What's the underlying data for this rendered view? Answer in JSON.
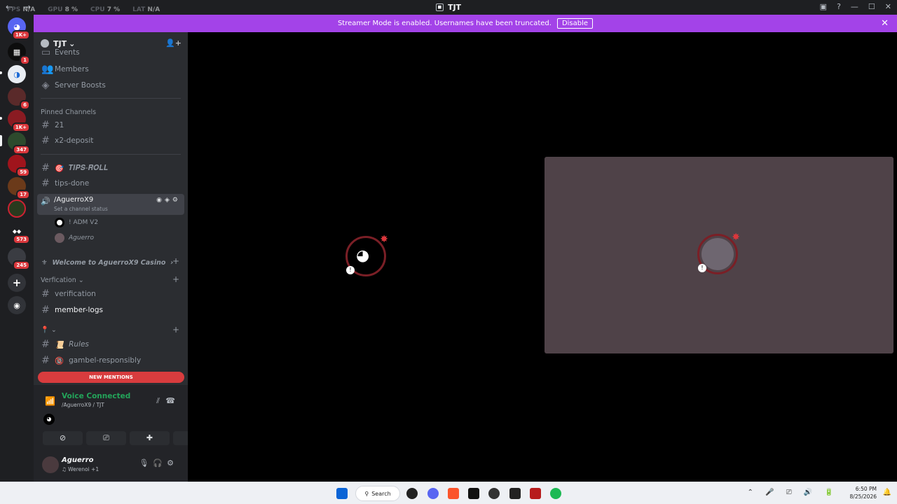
{
  "titlebar": {
    "title": "TJT",
    "stats": {
      "fps_label": "FPS",
      "fps": "N/A",
      "gpu_label": "GPU",
      "gpu": "8 %",
      "cpu_label": "CPU",
      "cpu": "7 %",
      "lat_label": "LAT",
      "lat": "N/A"
    }
  },
  "banner": {
    "text": "Streamer Mode is enabled. Usernames have been truncated.",
    "button": "Disable"
  },
  "guilds": [
    {
      "badge": "1K+"
    },
    {
      "badge": "1"
    },
    {
      "badge": ""
    },
    {
      "badge": "6"
    },
    {
      "badge": "1K+"
    },
    {
      "badge": "347"
    },
    {
      "badge": "59"
    },
    {
      "badge": "17"
    },
    {
      "badge": ""
    },
    {
      "badge": "573"
    },
    {
      "badge": "245"
    }
  ],
  "server": {
    "name": "TJT"
  },
  "sidebar": {
    "top": [
      "Events",
      "Members",
      "Server Boosts"
    ],
    "pinned_header": "Pinned Channels",
    "pinned": [
      "21",
      "x2-deposit"
    ],
    "channels": [
      "𝑻𝑰𝑷𝑺-𝑹𝑶𝑳𝑳",
      "tips-done"
    ],
    "voice": {
      "name": "/AguerroX9",
      "status": "Set a channel status",
      "users": [
        "! ADM V2",
        "Aguerro"
      ]
    },
    "welcome": "Welcome to AguerroX9 Casino",
    "cat_verification": "Verfication",
    "verification_channels": [
      "verification",
      "member-logs"
    ],
    "rules_channels": [
      "Rules",
      "gambel-responsibly"
    ],
    "new_mentions": "NEW MENTIONS"
  },
  "panel": {
    "voice_connected": "Voice Connected",
    "voice_sub": "/AguerroX9 / TJT",
    "username": "Aguerro",
    "user_status": "Werenoi +1"
  },
  "taskbar": {
    "search": "Search",
    "time": "6:50 PM",
    "date": "8/25/2026"
  }
}
